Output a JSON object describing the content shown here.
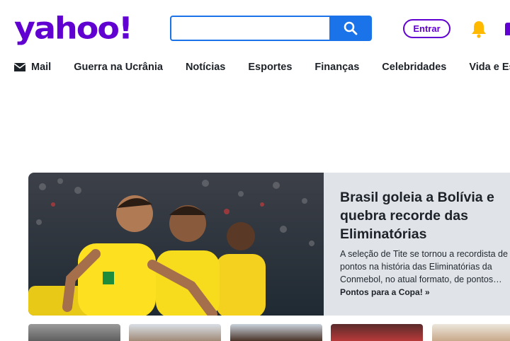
{
  "brand": {
    "logo_text": "yahoo!",
    "accent": "#6001d2",
    "search_blue": "#1a73e8"
  },
  "search": {
    "value": "",
    "button_icon": "search-icon"
  },
  "header": {
    "signin_label": "Entrar",
    "notifications_icon": "bell-icon"
  },
  "nav": {
    "items": [
      {
        "label": "Mail",
        "icon": "mail-icon"
      },
      {
        "label": "Guerra na Ucrânia"
      },
      {
        "label": "Notícias"
      },
      {
        "label": "Esportes"
      },
      {
        "label": "Finanças"
      },
      {
        "label": "Celebridades"
      },
      {
        "label": "Vida e Estilo"
      }
    ]
  },
  "hero": {
    "title": "Brasil goleia a Bolívia e quebra recorde das Eliminatórias",
    "summary": "A seleção de Tite se tornou a recordista de pontos na história das Eliminatórias da Conmebol, no atual formato, de pontos…",
    "link_label": "Pontos para a Copa! »"
  }
}
